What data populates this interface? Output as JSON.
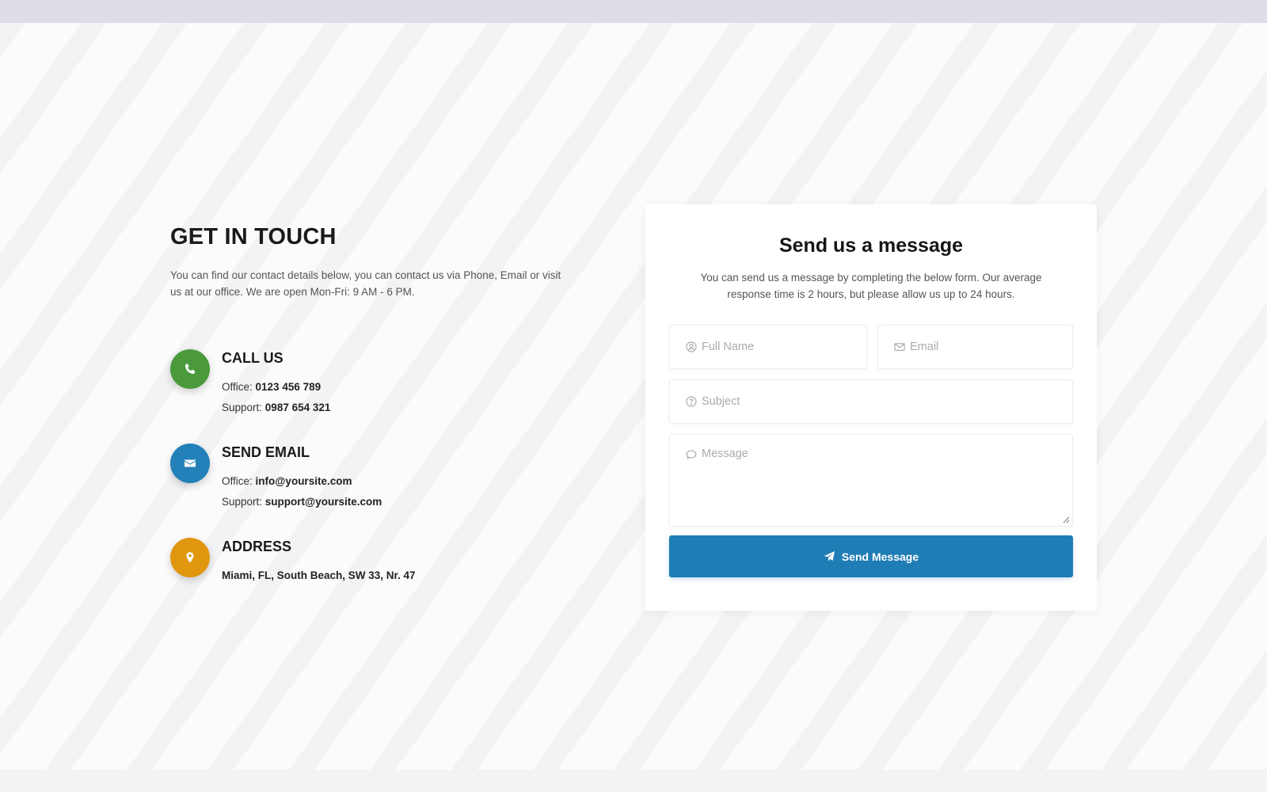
{
  "contact": {
    "heading": "GET IN TOUCH",
    "intro": "You can find our contact details below, you can contact us via Phone, Email or visit us at our office. We are open Mon-Fri: 9 AM - 6 PM.",
    "items": [
      {
        "title": "CALL US",
        "icon": "phone-icon",
        "color": "#4a9a3b",
        "lines": [
          {
            "label": "Office: ",
            "value": "0123 456 789"
          },
          {
            "label": "Support: ",
            "value": "0987 654 321"
          }
        ]
      },
      {
        "title": "SEND EMAIL",
        "icon": "envelope-icon",
        "color": "#2380b8",
        "lines": [
          {
            "label": "Office: ",
            "value": "info@yoursite.com"
          },
          {
            "label": "Support: ",
            "value": "support@yoursite.com"
          }
        ]
      },
      {
        "title": "ADDRESS",
        "icon": "map-pin-icon",
        "color": "#e0960f",
        "lines": [
          {
            "label": "",
            "value": "Miami, FL, South Beach, SW 33, Nr. 47"
          }
        ]
      }
    ]
  },
  "form": {
    "title": "Send us a message",
    "description": "You can send us a message by completing the below form. Our average response time is 2 hours, but please allow us up to 24 hours.",
    "full_name": {
      "placeholder": "Full Name",
      "value": "",
      "icon": "user-circle-icon"
    },
    "email": {
      "placeholder": "Email",
      "value": "",
      "icon": "envelope-outline-icon"
    },
    "subject": {
      "placeholder": "Subject",
      "value": "",
      "icon": "question-circle-icon"
    },
    "message": {
      "placeholder": "Message",
      "value": "",
      "icon": "comment-icon"
    },
    "submit_label": "Send Message",
    "submit_icon": "paper-plane-icon",
    "accent": "#1f7db5"
  }
}
